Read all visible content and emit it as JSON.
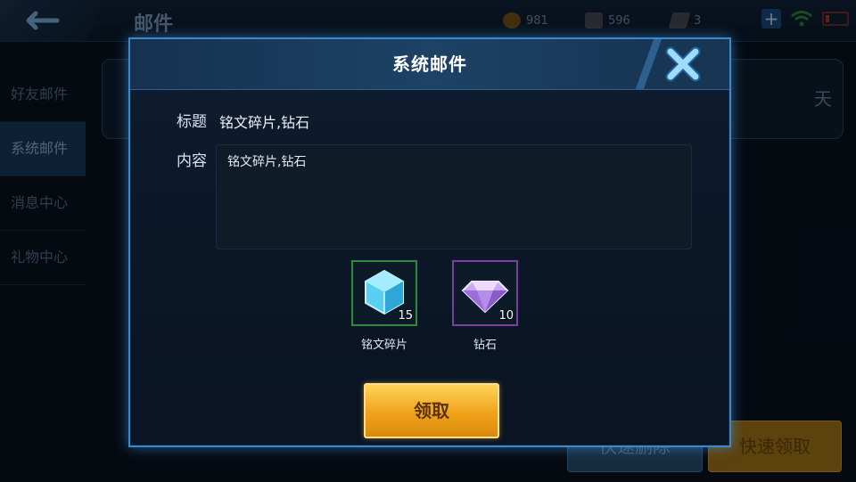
{
  "app": {
    "page_title": "邮件",
    "resources": [
      {
        "icon": "gold-coin-icon",
        "value": "981",
        "color": "#c98a2b"
      },
      {
        "icon": "diamond-icon",
        "value": "596",
        "color": "#8c8f99"
      },
      {
        "icon": "ticket-icon",
        "value": "3",
        "color": "#8c8f99"
      }
    ]
  },
  "sidebar": {
    "items": [
      {
        "label": "好友邮件",
        "active": false
      },
      {
        "label": "系统邮件",
        "active": true
      },
      {
        "label": "消息中心",
        "active": false
      },
      {
        "label": "礼物中心",
        "active": false
      }
    ]
  },
  "mail_list": {
    "days_label": "天"
  },
  "bottom_buttons": {
    "delete_label": "快速删除",
    "claim_all_label": "快速领取"
  },
  "modal": {
    "title": "系统邮件",
    "subject_label": "标题",
    "subject_value": "铭文碎片,钻石",
    "content_label": "内容",
    "content_value": "铭文碎片,钻石",
    "rewards": [
      {
        "icon": "inscription-fragment-icon",
        "name": "铭文碎片",
        "count": "15",
        "border_color": "#2f8a3e"
      },
      {
        "icon": "diamond-gem-icon",
        "name": "钻石",
        "count": "10",
        "border_color": "#7d3f9c"
      }
    ],
    "claim_label": "领取"
  },
  "colors": {
    "accent_blue": "#3e88c9",
    "claim_gold": "#f0a21a"
  }
}
